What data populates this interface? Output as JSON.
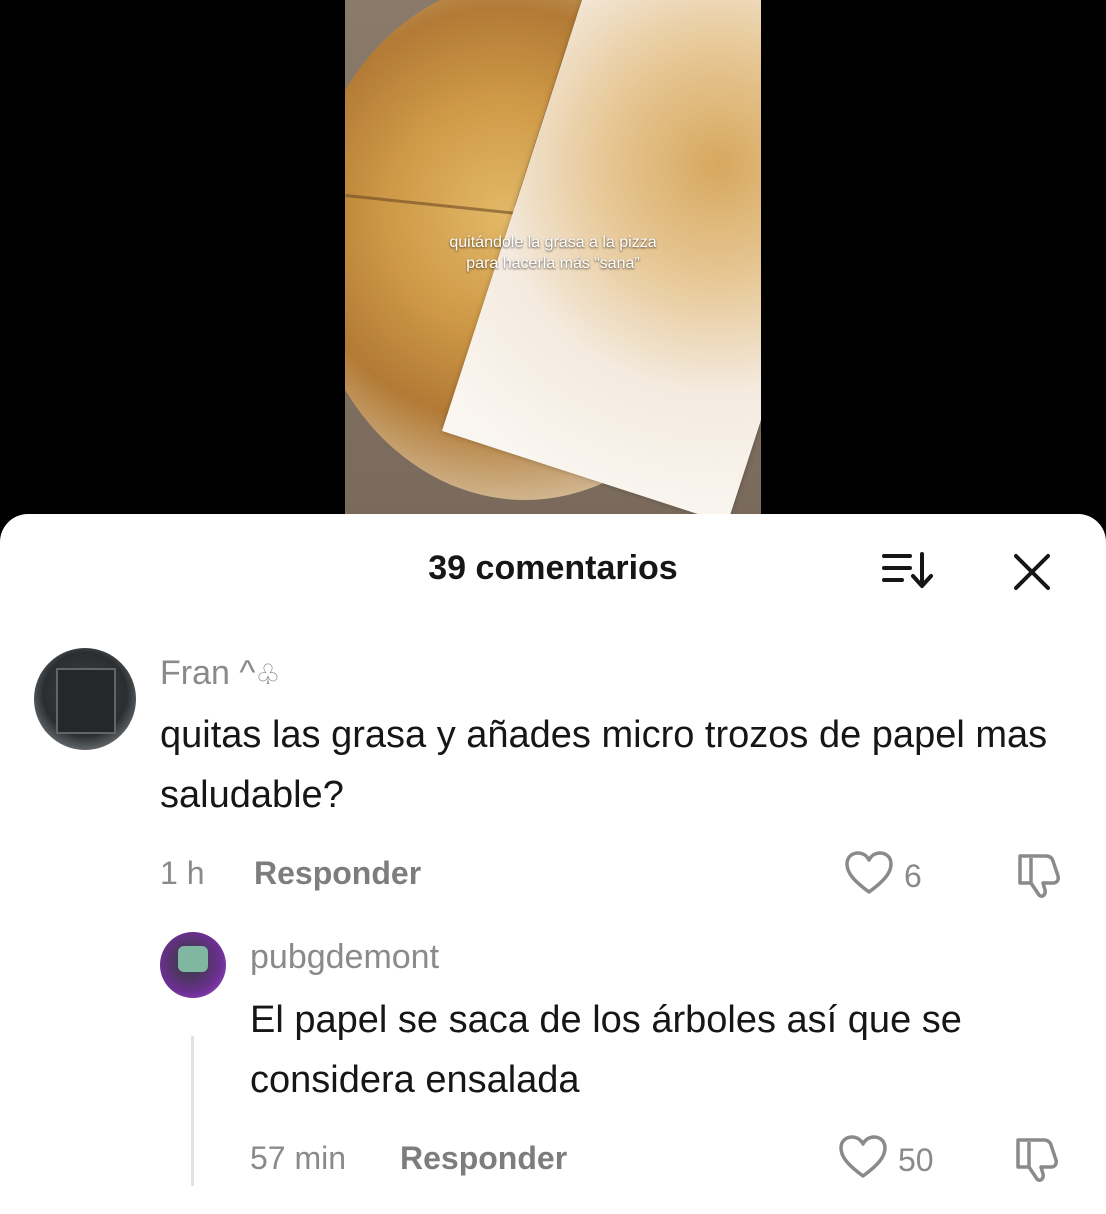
{
  "video": {
    "caption_line1": "quitándole la grasa a la pizza",
    "caption_line2": "para hacerla más “sana”"
  },
  "comments_panel": {
    "title": "39 comentarios",
    "sort_icon": "sort-icon",
    "close_icon": "close-icon"
  },
  "comments": [
    {
      "username": "Fran ^",
      "username_symbol": "♧",
      "text": "quitas las grasa y añades micro trozos de papel mas saludable?",
      "time": "1 h",
      "reply_label": "Responder",
      "likes": "6"
    },
    {
      "username": "pubgdemont",
      "text": "El papel se saca de los árboles así que se considera ensalada",
      "time": "57 min",
      "reply_label": "Responder",
      "likes": "50"
    }
  ],
  "colors": {
    "text_primary": "#161616",
    "text_secondary": "#8a8a8a",
    "background": "#ffffff"
  }
}
